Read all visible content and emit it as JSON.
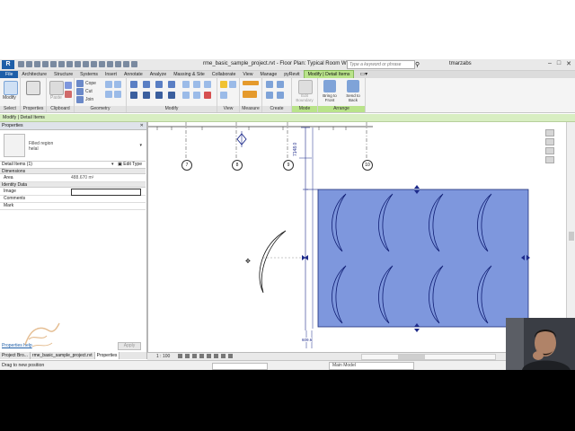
{
  "window": {
    "app_logo": "R",
    "title": "rme_basic_sample_project.rvt - Floor Plan: Typical Room WSHF",
    "search_placeholder": "Type a keyword or phrase",
    "user": "tmarzabs",
    "window_controls": [
      "–",
      "□",
      "✕"
    ]
  },
  "menu_tabs": [
    {
      "label": "File",
      "kind": "file"
    },
    {
      "label": "Architecture"
    },
    {
      "label": "Structure"
    },
    {
      "label": "Systems"
    },
    {
      "label": "Insert"
    },
    {
      "label": "Annotate"
    },
    {
      "label": "Analyze"
    },
    {
      "label": "Massing & Site"
    },
    {
      "label": "Collaborate"
    },
    {
      "label": "View"
    },
    {
      "label": "Manage"
    },
    {
      "label": "pyRevit"
    },
    {
      "label": "Modify | Detail Items",
      "kind": "context"
    }
  ],
  "ribbon": {
    "modify_label": "Modify",
    "paste_label": "Paste",
    "clipboard_items": [
      "Cope",
      "Cut",
      "Join"
    ],
    "edit_boundary_label": "Edit Boundary",
    "bring_to_front_label": "Bring to Front",
    "send_to_back_label": "Send to Back",
    "panels": [
      "Select",
      "Properties",
      "Clipboard",
      "Geometry",
      "Modify",
      "View",
      "Measure",
      "Create",
      "Mode",
      "Arrange"
    ]
  },
  "option_bar": {
    "text": "Modify | Detail Items"
  },
  "properties": {
    "header": "Properties",
    "close": "✕",
    "type_name_line1": "Filled region",
    "type_name_line2": "helal",
    "instance_label": "Detail Items (1)",
    "edit_type_label": "Edit Type",
    "sections": [
      {
        "name": "Dimensions",
        "rows": [
          {
            "key": "Area",
            "value": "488.670 m²"
          }
        ]
      },
      {
        "name": "Identity Data",
        "rows": [
          {
            "key": "Image",
            "value": ""
          },
          {
            "key": "Comments",
            "value": ""
          },
          {
            "key": "Mark",
            "value": ""
          }
        ]
      }
    ],
    "help_link": "Properties help",
    "apply_label": "Apply"
  },
  "browser_tabs": [
    "Project Bro...",
    "rme_basic_sample_project.rvt",
    "Properties"
  ],
  "canvas": {
    "grid_labels": [
      "7",
      "8",
      "9",
      "10"
    ],
    "dim_vertical": "7148.0",
    "dim_bottom": "609.6",
    "region_color": "#7e97dd",
    "region_edge_color": "#1e2f7a",
    "accent_color": "#0b1b8f"
  },
  "view_control": {
    "scale": "1 : 100"
  },
  "status": {
    "message": "Drag to new position",
    "workset": "Main Model"
  }
}
